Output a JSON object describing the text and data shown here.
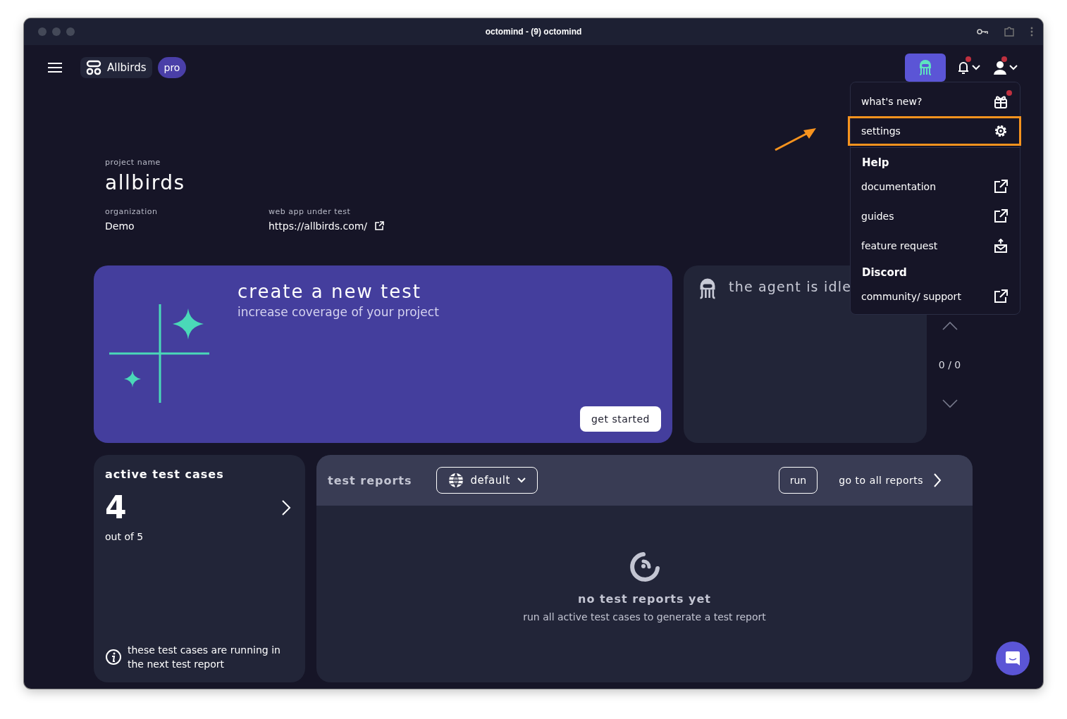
{
  "window": {
    "title": "octomind - (9) octomind"
  },
  "topbar": {
    "workspace": "Allbirds",
    "plan": "pro",
    "notifications_badge": true,
    "account_badge": true
  },
  "menu": [
    {
      "kind": "whats-new",
      "label": "what's new?",
      "highlighted": false,
      "badge": true
    },
    {
      "kind": "settings",
      "label": "settings",
      "highlighted": true,
      "badge": false
    },
    {
      "kind": "heading",
      "label": "Help"
    },
    {
      "kind": "link",
      "label": "documentation",
      "highlighted": false,
      "badge": false
    },
    {
      "kind": "link",
      "label": "guides",
      "highlighted": false,
      "badge": false
    },
    {
      "kind": "feedback",
      "label": "feature request",
      "highlighted": false,
      "badge": false
    },
    {
      "kind": "heading",
      "label": "Discord"
    },
    {
      "kind": "link",
      "label": "community/ support",
      "highlighted": false,
      "badge": false
    }
  ],
  "project": {
    "name_label": "project name",
    "name": "allbirds",
    "org_label": "organization",
    "org": "Demo",
    "url_label": "web app under test",
    "url": "https://allbirds.com/"
  },
  "create_card": {
    "title": "create a new test",
    "subtitle": "increase coverage of your project",
    "button": "get started"
  },
  "agent_card": {
    "status": "the agent is idle",
    "pager": "0 / 0"
  },
  "active_card": {
    "title": "active test cases",
    "count": "4",
    "sub": "out of 5",
    "note": "these test cases are running in the next test report"
  },
  "reports": {
    "title": "test reports",
    "environment": "default",
    "run": "run",
    "all": "go to all reports",
    "empty_title": "no test reports yet",
    "empty_text": "run all active test cases to generate a test report"
  }
}
